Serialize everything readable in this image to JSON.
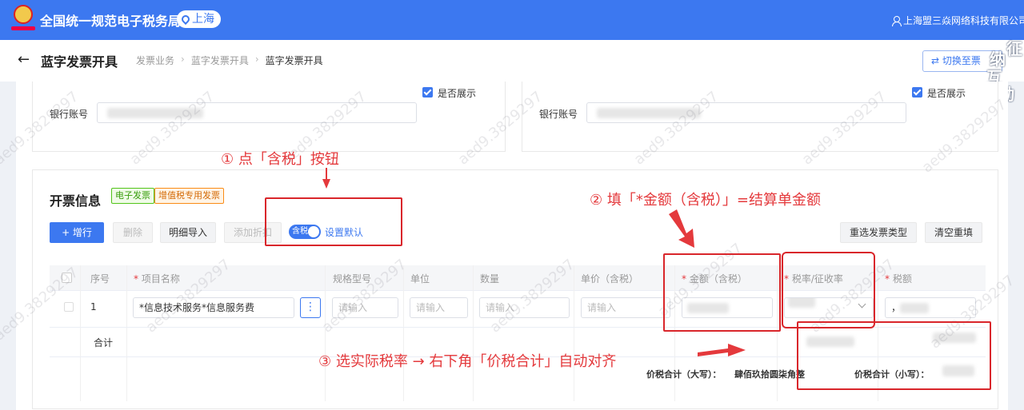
{
  "header": {
    "app_title": "全国统一规范电子税务局",
    "region": "上海",
    "user": "上海盟三焱网络科技有限公司"
  },
  "page": {
    "title": "蓝字发票开具",
    "breadcrumb": [
      "发票业务",
      "蓝字发票开具",
      "蓝字发票开具"
    ],
    "switch_button": "切换至票"
  },
  "float_badge": [
    "征",
    "纳",
    "互",
    "动"
  ],
  "bank": {
    "show_label": "是否展示",
    "account_label": "银行账号"
  },
  "section": {
    "title": "开票信息",
    "tags": [
      "电子发票",
      "增值税专用发票"
    ],
    "toolbar": {
      "add": "+ 增行",
      "delete": "删除",
      "import": "明细导入",
      "discount": "添加折扣",
      "tax_toggle": "含税",
      "set_default": "设置默认",
      "reselect_type": "重选发票类型",
      "clear_refill": "清空重填"
    }
  },
  "table": {
    "columns": [
      {
        "label": "序号",
        "required": false
      },
      {
        "label": "项目名称",
        "required": true
      },
      {
        "label": "规格型号",
        "required": false
      },
      {
        "label": "单位",
        "required": false
      },
      {
        "label": "数量",
        "required": false
      },
      {
        "label": "单价（含税）",
        "required": false
      },
      {
        "label": "金额（含税）",
        "required": true
      },
      {
        "label": "税率/征收率",
        "required": true
      },
      {
        "label": "税额",
        "required": true
      }
    ],
    "row": {
      "index": "1",
      "item_name": "*信息技术服务*信息服务费",
      "placeholder": "请输入",
      "tax_prefix": "，"
    },
    "subtotal_label": "合计"
  },
  "totals": {
    "upper_label": "价税合计（大写）：",
    "upper_value": "肆佰玖拾圆柒角整",
    "lower_label": "价税合计（小写）："
  },
  "annotations": {
    "step1": "① 点「含税」按钮",
    "step2": "② 填「*金额（含税）」=结算单金额",
    "step3": "③ 选实际税率 → 右下角「价税合计」自动对齐"
  },
  "watermark": "aed9.3829297",
  "colors": {
    "brand": "#3c78f0",
    "annotation": "#e4393c"
  }
}
